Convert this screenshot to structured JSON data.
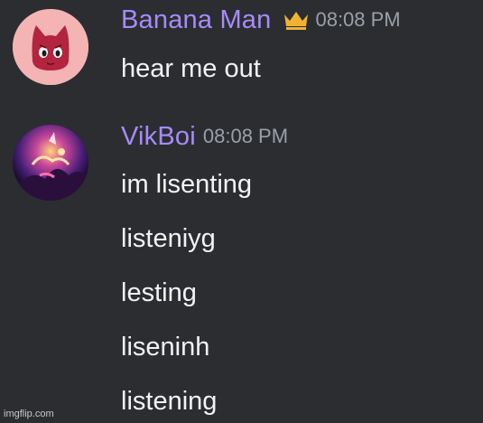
{
  "messages": [
    {
      "username": "Banana Man",
      "username_color": "#a78bfa",
      "badge": "crown-icon",
      "badge_color": "#f0b232",
      "timestamp": "08:08 PM",
      "lines": [
        "hear me out"
      ]
    },
    {
      "username": "VikBoi",
      "username_color": "#a78bfa",
      "timestamp": "08:08 PM",
      "lines": [
        "im lisenting",
        "listeniyg",
        "lesting",
        "liseninh",
        "listening"
      ]
    }
  ],
  "watermark": "imgflip.com",
  "colors": {
    "background": "#2b2d31",
    "text": "#f2f3f5",
    "timestamp": "#9aa0a8"
  }
}
